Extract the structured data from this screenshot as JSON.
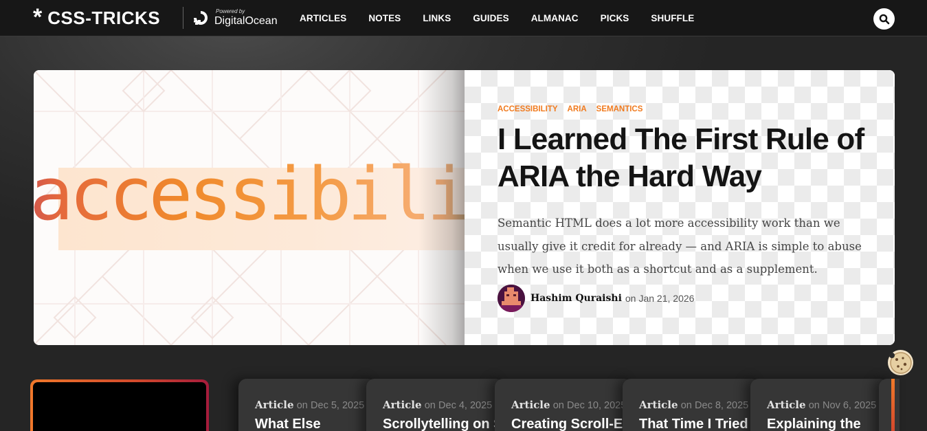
{
  "header": {
    "logo_star": "*",
    "logo_text": "CSS-TRICKS",
    "powered_by": "Powered by",
    "sponsor": "DigitalOcean",
    "nav": [
      "ARTICLES",
      "NOTES",
      "LINKS",
      "GUIDES",
      "ALMANAC",
      "PICKS",
      "SHUFFLE"
    ],
    "search_icon": "search-icon"
  },
  "hero": {
    "image_word": "accessibility",
    "tags": [
      "ACCESSIBILITY",
      "ARIA",
      "SEMANTICS"
    ],
    "title": "I Learned The First Rule of ARIA the Hard Way",
    "excerpt": "Semantic HTML does a lot more accessibility work than we usually give it credit for already — and ARIA is simple to abuse when we use it both as a shortcut and as a supplement.",
    "author": "Hashim Quraishi",
    "on": "on",
    "date": "Jan 21, 2026"
  },
  "cards": [
    {
      "type": "Article",
      "on": "on",
      "date": "Dec 5, 2025",
      "title": "What Else"
    },
    {
      "type": "Article",
      "on": "on",
      "date": "Dec 4, 2025",
      "title": "Scrollytelling on S"
    },
    {
      "type": "Article",
      "on": "on",
      "date": "Dec 10, 2025",
      "title": "Creating Scroll-E"
    },
    {
      "type": "Article",
      "on": "on",
      "date": "Dec 8, 2025",
      "title": "That Time I Tried"
    },
    {
      "type": "Article",
      "on": "on",
      "date": "Nov 6, 2025",
      "title": "Explaining the"
    }
  ],
  "colors": {
    "accent": "#f07a1e",
    "header_bg": "#171717",
    "page_bg": "#2d2d2d",
    "card_bg": "#363636"
  },
  "icons": {
    "cookie": "cookie-icon",
    "digitalocean": "digitalocean-icon"
  }
}
